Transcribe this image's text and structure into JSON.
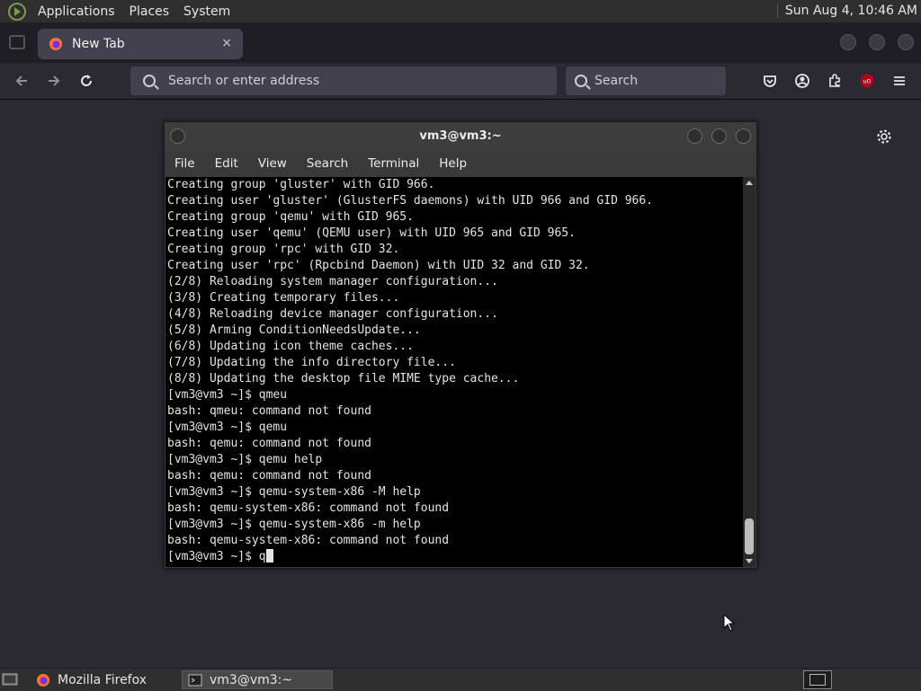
{
  "top_panel": {
    "menus": [
      "Applications",
      "Places",
      "System"
    ],
    "clock": "Sun Aug  4, 10:46 AM"
  },
  "browser": {
    "tab_title": "New Tab",
    "tab_close": "×",
    "address_placeholder": "Search or enter address",
    "search_placeholder": "Search"
  },
  "terminal": {
    "title": "vm3@vm3:~",
    "menu": [
      "File",
      "Edit",
      "View",
      "Search",
      "Terminal",
      "Help"
    ],
    "lines": [
      "Creating group 'gluster' with GID 966.",
      "Creating user 'gluster' (GlusterFS daemons) with UID 966 and GID 966.",
      "Creating group 'qemu' with GID 965.",
      "Creating user 'qemu' (QEMU user) with UID 965 and GID 965.",
      "Creating group 'rpc' with GID 32.",
      "Creating user 'rpc' (Rpcbind Daemon) with UID 32 and GID 32.",
      "(2/8) Reloading system manager configuration...",
      "(3/8) Creating temporary files...",
      "(4/8) Reloading device manager configuration...",
      "(5/8) Arming ConditionNeedsUpdate...",
      "(6/8) Updating icon theme caches...",
      "(7/8) Updating the info directory file...",
      "(8/8) Updating the desktop file MIME type cache...",
      "[vm3@vm3 ~]$ qmeu",
      "bash: qmeu: command not found",
      "[vm3@vm3 ~]$ qemu",
      "bash: qemu: command not found",
      "[vm3@vm3 ~]$ qemu help",
      "bash: qemu: command not found",
      "[vm3@vm3 ~]$ qemu-system-x86 -M help",
      "bash: qemu-system-x86: command not found",
      "[vm3@vm3 ~]$ qemu-system-x86 -m help",
      "bash: qemu-system-x86: command not found"
    ],
    "prompt": "[vm3@vm3 ~]$ ",
    "current_input": "q"
  },
  "taskbar": {
    "items": [
      "Mozilla Firefox",
      "vm3@vm3:~"
    ]
  },
  "colors": {
    "panel_bg": "#2f2f2f",
    "browser_bg": "#2b2a33",
    "terminal_bg": "#000000",
    "terminal_fg": "#e4e4e4",
    "ublock_red": "#b5001b"
  }
}
